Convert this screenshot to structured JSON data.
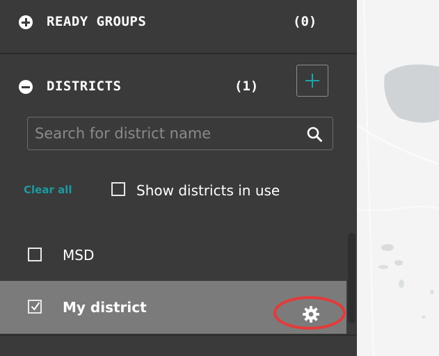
{
  "ready_groups": {
    "title": "READY GROUPS",
    "count": "(0)",
    "expand_icon": "plus-circle-icon"
  },
  "districts": {
    "title": "DISTRICTS",
    "count": "(1)",
    "collapse_icon": "minus-circle-icon",
    "add_button_icon": "plus-icon"
  },
  "search": {
    "placeholder": "Search for district name",
    "value": "",
    "icon": "search-icon"
  },
  "filters": {
    "clear_all_label": "Clear all",
    "show_in_use_label": "Show districts in use",
    "show_in_use_checked": false
  },
  "district_list": [
    {
      "label": "MSD",
      "checked": false,
      "selected": false
    },
    {
      "label": "My district",
      "checked": true,
      "selected": true,
      "settings_icon": "gear-icon"
    }
  ],
  "colors": {
    "sidebar_bg": "#3a3a3a",
    "selected_row_bg": "#7b7b7b",
    "accent_teal": "#1fa5a9",
    "highlight_ring": "#e53a3a",
    "map_bg": "#f3f3f3"
  }
}
